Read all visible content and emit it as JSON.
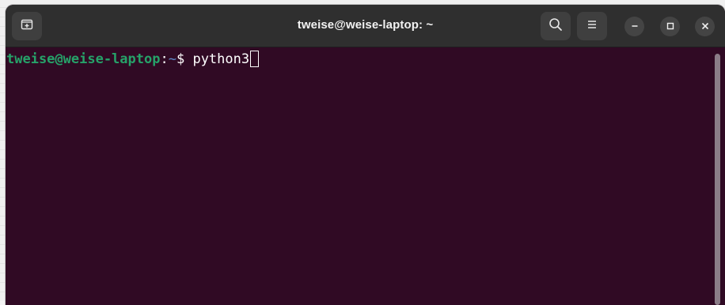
{
  "window": {
    "title": "tweise@weise-laptop: ~"
  },
  "titlebar": {
    "new_tab_icon": "new-tab-icon",
    "search_icon": "search-icon",
    "menu_icon": "hamburger-menu-icon",
    "minimize_icon": "minimize-icon",
    "maximize_icon": "maximize-icon",
    "close_icon": "close-icon"
  },
  "terminal": {
    "user_host": "tweise@weise-laptop",
    "colon": ":",
    "cwd": "~",
    "prompt_symbol": "$ ",
    "command": "python3"
  },
  "colors": {
    "terminal_bg": "#300a24",
    "titlebar_bg": "#2f2f2f",
    "user_host": "#26a269",
    "cwd": "#5f88c8",
    "text": "#ffffff"
  }
}
